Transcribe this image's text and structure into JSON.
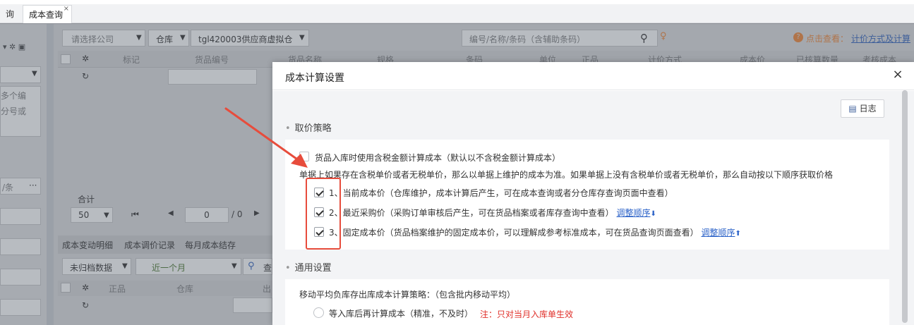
{
  "tabs": {
    "prev_label": "询",
    "current_label": "成本查询",
    "current_close": "×"
  },
  "toolbar": {
    "company_placeholder": "请选择公司",
    "warehouse_label": "仓库",
    "warehouse_value": "tgl420003供应商虚拟仓",
    "search_placeholder": "编号/名称/条码（含辅助条码）",
    "hint_label": "点击查看：",
    "hint_link": "计价方式及计算"
  },
  "grid": {
    "columns": [
      "标记",
      "货品编号",
      "货品名称",
      "规格",
      "条码",
      "单位",
      "正品",
      "计价方式",
      "成本价",
      "已核算数量",
      "考核成本"
    ],
    "total_label": "合计",
    "page_size": "50",
    "page_current": "0",
    "page_total": "/ 0"
  },
  "left": {
    "text1": "多个编",
    "text2": "分号或",
    "text3": "/条",
    "more": "···"
  },
  "bottom_tabs": [
    "成本变动明细",
    "成本调价记录",
    "每月成本结存"
  ],
  "bottom_filters": {
    "archive": "未归档数据",
    "period": "近一个月",
    "query": "查"
  },
  "bottom_grid": {
    "col1": "正品",
    "col2": "仓库",
    "col3": "出"
  },
  "modal": {
    "title": "成本计算设置",
    "close": "×",
    "log_button": "日志",
    "section1_title": "取价策略",
    "tax_option": "货品入库时使用含税金额计算成本（默认以不含税金额计算成本）",
    "rule_text": "单据上如果存在含税单价或者无税单价，那么以单据上维护的成本为准。如果单据上没有含税单价或者无税单价，那么自动按以下顺序获取价格",
    "options": [
      {
        "text": "1、当前成本价（仓库维护，成本计算后产生，可在成本查询或者分仓库存查询页面中查看）",
        "link": "",
        "arrow": ""
      },
      {
        "text": "2、最近采购价（采购订单审核后产生，可在货品档案或者库存查询中查看）",
        "link": "调整顺序",
        "arrow": "⬇"
      },
      {
        "text": "3、固定成本价（货品档案维护的固定成本价，可以理解成参考标准成本，可在货品查询页面查看）",
        "link": "调整顺序",
        "arrow": "⬆"
      }
    ],
    "section2_title": "通用设置",
    "moving_avg_text": "移动平均负库存出库成本计算策略：（包含批内移动平均）",
    "radio1_text": "等入库后再计算成本（精准，不及时）",
    "radio1_note": "注：只对当月入库单生效"
  },
  "colors": {
    "annotation_red": "#e74c3c",
    "link_blue": "#2b62c8",
    "note_red": "#e0302a"
  }
}
